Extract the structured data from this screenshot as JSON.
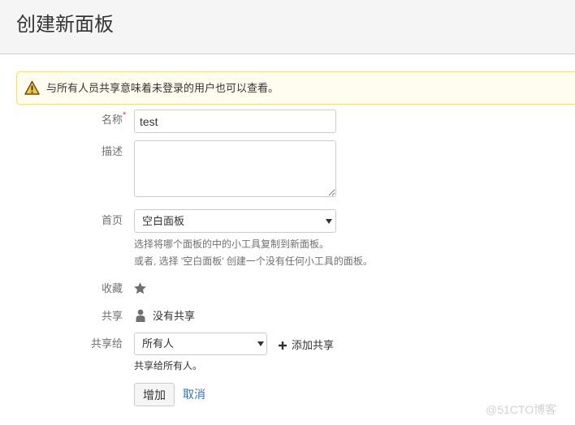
{
  "dialog": {
    "title": "创建新面板"
  },
  "warning": {
    "icon": "warning-icon",
    "text": "与所有人员共享意味着未登录的用户也可以查看。"
  },
  "form": {
    "name": {
      "label": "名称",
      "required_mark": "*",
      "value": "test"
    },
    "description": {
      "label": "描述",
      "value": ""
    },
    "homepage": {
      "label": "首页",
      "value": "空白面板",
      "help_1": "选择将哪个面板的中的小工具复制到新面板。",
      "help_2": "或者, 选择 '空白面板' 创建一个没有任何小工具的面板。"
    },
    "favourite": {
      "label": "收藏",
      "icon": "star-icon"
    },
    "shares": {
      "label": "共享",
      "icon": "person-icon",
      "value": "没有共享"
    },
    "share_with": {
      "label": "共享给",
      "value": "所有人",
      "add_icon": "plus-icon",
      "add_label": "添加共享",
      "help": "共享给所有人。"
    }
  },
  "buttons": {
    "submit": "增加",
    "cancel": "取消"
  },
  "watermark": "@51CTO博客",
  "colors": {
    "link": "#3572b0",
    "required": "#d04437",
    "muted": "#707070",
    "warning_bg": "#fffdf0",
    "warning_border": "#f6d88a"
  }
}
